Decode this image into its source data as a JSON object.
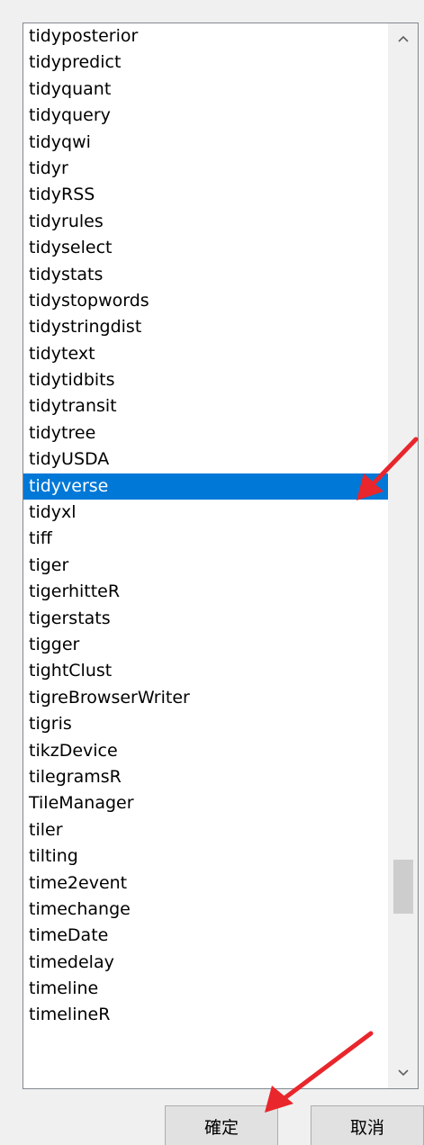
{
  "listbox": {
    "items": [
      "tidyposterior",
      "tidypredict",
      "tidyquant",
      "tidyquery",
      "tidyqwi",
      "tidyr",
      "tidyRSS",
      "tidyrules",
      "tidyselect",
      "tidystats",
      "tidystopwords",
      "tidystringdist",
      "tidytext",
      "tidytidbits",
      "tidytransit",
      "tidytree",
      "tidyUSDA",
      "tidyverse",
      "tidyxl",
      "tiff",
      "tiger",
      "tigerhitteR",
      "tigerstats",
      "tigger",
      "tightClust",
      "tigreBrowserWriter",
      "tigris",
      "tikzDevice",
      "tilegramsR",
      "TileManager",
      "tiler",
      "tilting",
      "time2event",
      "timechange",
      "timeDate",
      "timedelay",
      "timeline",
      "timelineR"
    ],
    "selected_index": 17,
    "scroll_up_icon": "chevron-up-icon",
    "scroll_down_icon": "chevron-down-icon"
  },
  "buttons": {
    "ok_label": "確定",
    "cancel_label": "取消"
  },
  "colors": {
    "selection": "#0078d7",
    "annotation_arrow": "#e8262c"
  }
}
